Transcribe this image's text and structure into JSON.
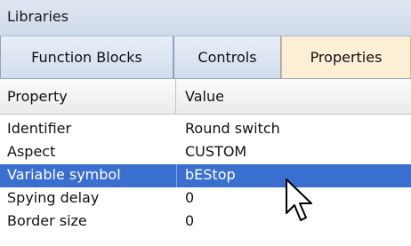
{
  "panel": {
    "title": "Libraries"
  },
  "tabs": [
    {
      "label": "Function Blocks"
    },
    {
      "label": "Controls"
    },
    {
      "label": "Properties"
    }
  ],
  "grid": {
    "headers": {
      "property": "Property",
      "value": "Value"
    },
    "rows": [
      {
        "property": "Identifier",
        "value": "Round switch"
      },
      {
        "property": "Aspect",
        "value": "CUSTOM"
      },
      {
        "property": "Variable symbol",
        "value": "bEStop"
      },
      {
        "property": "Spying delay",
        "value": "0"
      },
      {
        "property": "Border size",
        "value": "0"
      }
    ],
    "selected_index": 2
  },
  "colors": {
    "selection": "#3a6fcf",
    "active_tab": "#fcefd6"
  }
}
